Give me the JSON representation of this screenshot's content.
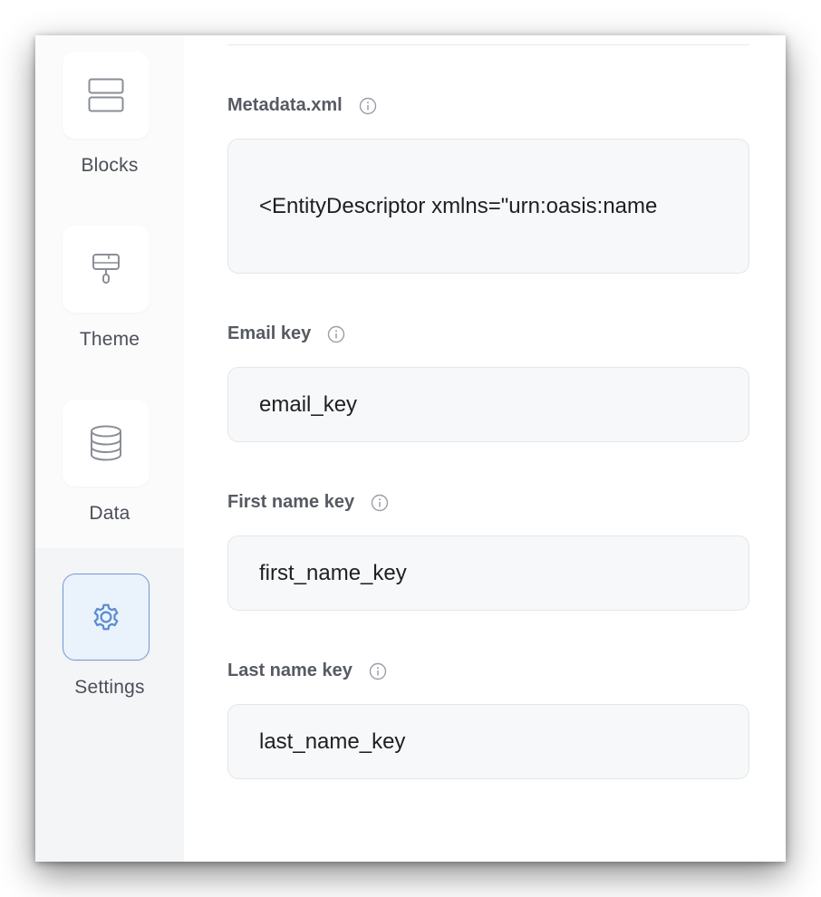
{
  "sidebar": {
    "items": [
      {
        "label": "Blocks",
        "icon": "blocks-icon",
        "active": false
      },
      {
        "label": "Theme",
        "icon": "paint-roller-icon",
        "active": false
      },
      {
        "label": "Data",
        "icon": "database-icon",
        "active": false
      },
      {
        "label": "Settings",
        "icon": "gear-icon",
        "active": true
      }
    ]
  },
  "form": {
    "metadata": {
      "label": "Metadata.xml",
      "value": "<EntityDescriptor xmlns=\"urn:oasis:name"
    },
    "email_key": {
      "label": "Email key",
      "value": "email_key"
    },
    "first_name_key": {
      "label": "First name key",
      "value": "first_name_key"
    },
    "last_name_key": {
      "label": "Last name key",
      "value": "last_name_key"
    }
  },
  "colors": {
    "accent": "#6f9ad3",
    "active_tile_bg": "#eaf2fc",
    "label_text": "#565a62",
    "field_bg": "#f7f8f9"
  }
}
